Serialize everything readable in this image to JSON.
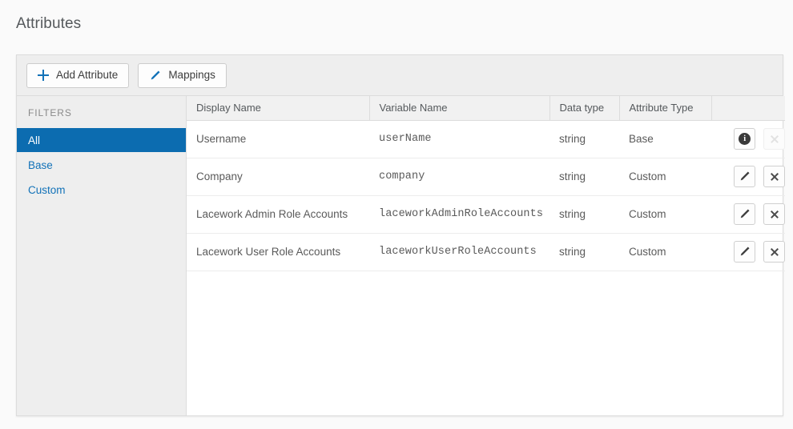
{
  "page": {
    "title": "Attributes"
  },
  "toolbar": {
    "add_attribute_label": "Add Attribute",
    "mappings_label": "Mappings",
    "accent_color": "#1272b8"
  },
  "sidebar": {
    "heading": "FILTERS",
    "selected": "All",
    "active_color": "#0c6cb0",
    "link_color": "#1272b8",
    "items": [
      {
        "label": "All",
        "active": true
      },
      {
        "label": "Base",
        "active": false
      },
      {
        "label": "Custom",
        "active": false
      }
    ]
  },
  "table": {
    "columns": [
      {
        "label": "Display Name"
      },
      {
        "label": "Variable Name"
      },
      {
        "label": "Data type"
      },
      {
        "label": "Attribute Type"
      },
      {
        "label": ""
      }
    ],
    "rows": [
      {
        "display_name": "Username",
        "variable_name": "userName",
        "data_type": "string",
        "attribute_type": "Base",
        "primary_action": "info-icon",
        "delete_disabled": true
      },
      {
        "display_name": "Company",
        "variable_name": "company",
        "data_type": "string",
        "attribute_type": "Custom",
        "primary_action": "pencil-icon",
        "delete_disabled": false
      },
      {
        "display_name": "Lacework Admin Role Accounts",
        "variable_name": "laceworkAdminRoleAccounts",
        "data_type": "string",
        "attribute_type": "Custom",
        "primary_action": "pencil-icon",
        "delete_disabled": false
      },
      {
        "display_name": "Lacework User Role Accounts",
        "variable_name": "laceworkUserRoleAccounts",
        "data_type": "string",
        "attribute_type": "Custom",
        "primary_action": "pencil-icon",
        "delete_disabled": false
      }
    ]
  },
  "icons": {
    "info_glyph": "i"
  }
}
